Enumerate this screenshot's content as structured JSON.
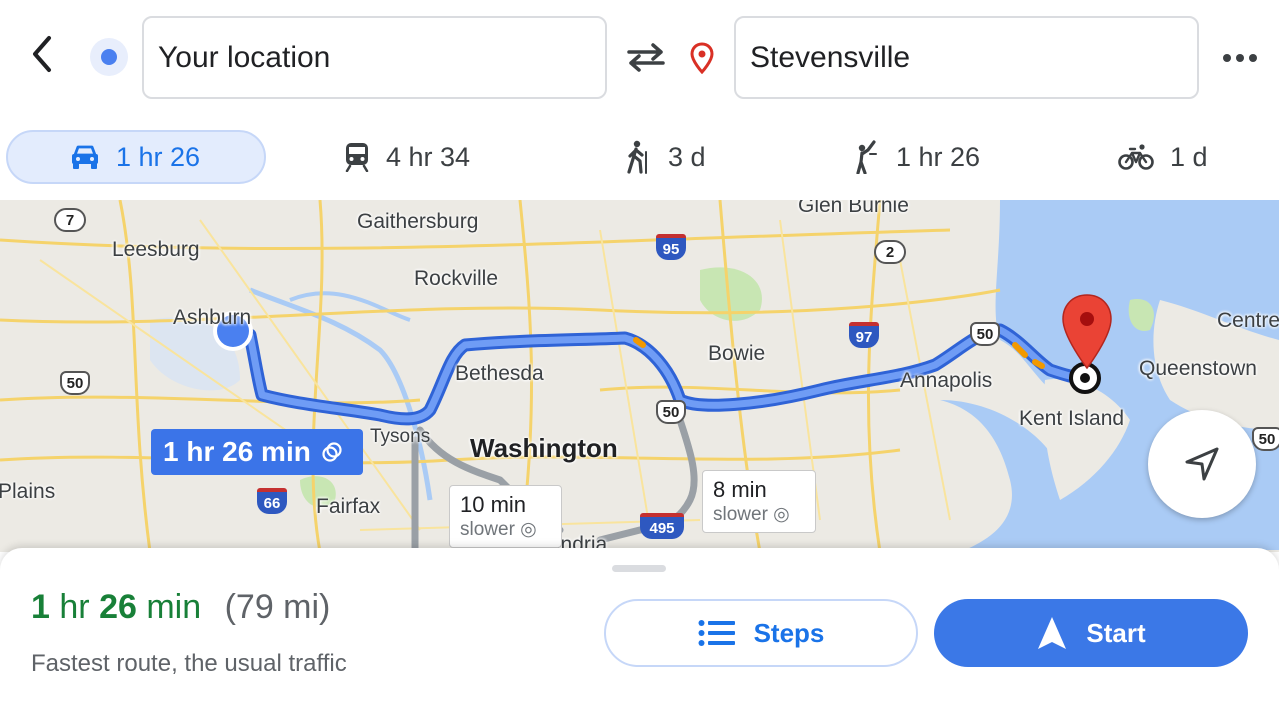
{
  "search": {
    "origin_value": "Your location",
    "destination_value": "Stevensville"
  },
  "icons": {
    "back": "chevron-left-icon",
    "origin": "current-location-dot-icon",
    "swap": "swap-arrows-icon",
    "destination": "location-pin-icon",
    "more": "more-horizontal-icon",
    "recenter": "navigation-arrow-icon"
  },
  "modes": [
    {
      "icon": "car-icon",
      "label": "1 hr 26",
      "active": true
    },
    {
      "icon": "train-icon",
      "label": "4 hr 34",
      "active": false
    },
    {
      "icon": "walk-icon",
      "label": "3 d",
      "active": false
    },
    {
      "icon": "ride-hail-icon",
      "label": "1 hr 26",
      "active": false
    },
    {
      "icon": "bicycle-icon",
      "label": "1 d",
      "active": false
    }
  ],
  "map": {
    "places": {
      "leesburg": "Leesburg",
      "gaithersburg": "Gaithersburg",
      "glen_burnie": "Glen Burnie",
      "rockville": "Rockville",
      "ashburn": "Ashburn",
      "bethesda": "Bethesda",
      "bowie": "Bowie",
      "annapolis": "Annapolis",
      "centre": "Centre",
      "queenstown": "Queenstown",
      "kent_island": "Kent Island",
      "tysons": "Tysons",
      "washington": "Washington",
      "plains": "Plains",
      "fairfax": "Fairfax",
      "alexandria": "Alexandria"
    },
    "shields": {
      "r7": "7",
      "i95": "95",
      "r2": "2",
      "us50_west": "50",
      "i97": "97",
      "us50_bridge": "50",
      "us50_dc": "50",
      "i66": "66",
      "i495": "495",
      "us50_east": "50"
    },
    "route_badge": "1 hr 26 min",
    "alt_routes": [
      {
        "time": "10 min",
        "note": "slower"
      },
      {
        "time": "8 min",
        "note": "slower"
      }
    ],
    "colors": {
      "route": "#4a80f0",
      "alt_route": "#9aa0a6",
      "water": "#aacbf5",
      "land": "#eceae4"
    }
  },
  "summary": {
    "eta_hr": "1",
    "eta_hr_unit": "hr",
    "eta_min": "26",
    "eta_min_unit": "min",
    "distance": "(79 mi)",
    "subtitle": "Fastest route, the usual traffic",
    "steps_label": "Steps",
    "start_label": "Start",
    "eta_color": "#188038"
  }
}
